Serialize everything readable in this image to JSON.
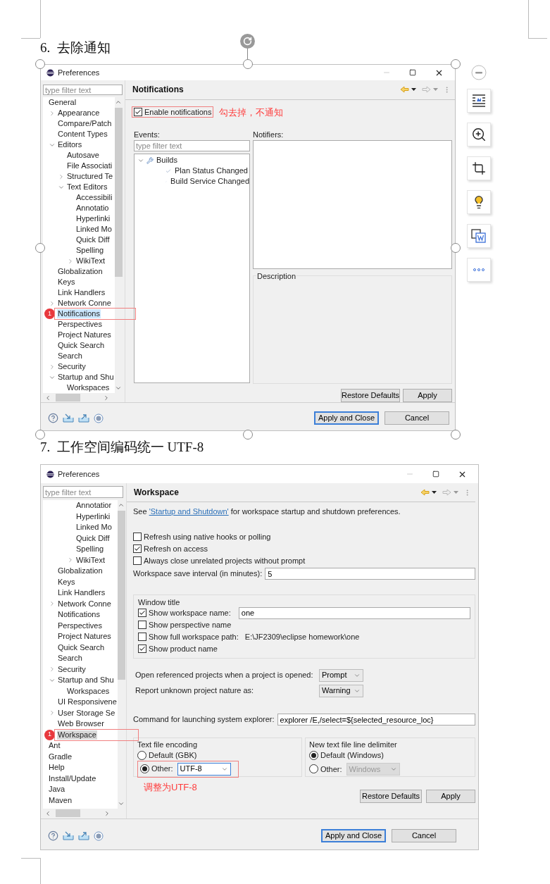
{
  "section_6": {
    "heading": "6.  去除通知",
    "dialog": {
      "title": "Preferences",
      "filter_placeholder": "type filter text",
      "tree": [
        {
          "label": "General",
          "selected": false,
          "children": [
            {
              "label": "Appearance",
              "expanded": false,
              "selected": false
            },
            {
              "label": "Compare/Patch",
              "selected": false
            },
            {
              "label": "Content Types",
              "selected": false
            },
            {
              "label": "Editors",
              "expanded": true,
              "selected": false,
              "children": [
                {
                  "label": "Autosave",
                  "selected": false
                },
                {
                  "label": "File Associati",
                  "selected": false
                },
                {
                  "label": "Structured Te",
                  "expanded": false,
                  "selected": false
                },
                {
                  "label": "Text Editors",
                  "expanded": true,
                  "selected": false,
                  "children": [
                    {
                      "label": "Accessibili",
                      "selected": false
                    },
                    {
                      "label": "Annotatio",
                      "selected": false
                    },
                    {
                      "label": "Hyperlinki",
                      "selected": false
                    },
                    {
                      "label": "Linked Mo",
                      "selected": false
                    },
                    {
                      "label": "Quick Diff",
                      "selected": false
                    },
                    {
                      "label": "Spelling",
                      "selected": false
                    },
                    {
                      "label": "WikiText",
                      "expanded": false,
                      "selected": false
                    }
                  ]
                }
              ]
            },
            {
              "label": "Globalization",
              "selected": false
            },
            {
              "label": "Keys",
              "selected": false
            },
            {
              "label": "Link Handlers",
              "selected": false
            },
            {
              "label": "Network Conne",
              "expanded": false,
              "selected": false
            },
            {
              "label": "Notifications",
              "selected": true,
              "marker": "1"
            },
            {
              "label": "Perspectives",
              "selected": false
            },
            {
              "label": "Project Natures",
              "selected": false
            },
            {
              "label": "Quick Search",
              "selected": false
            },
            {
              "label": "Search",
              "selected": false
            },
            {
              "label": "Security",
              "expanded": false,
              "selected": false
            },
            {
              "label": "Startup and Shu",
              "expanded": true,
              "selected": false,
              "children": [
                {
                  "label": "Workspaces",
                  "selected": false
                }
              ]
            }
          ]
        }
      ],
      "page_title": "Notifications",
      "enable_checkbox": {
        "label": "Enable notifications",
        "checked": true,
        "annotated": true
      },
      "annotation": "勾去掉，不通知",
      "events_label": "Events:",
      "events_filter_placeholder": "type filter text",
      "events": [
        {
          "label": "Builds",
          "expanded": true,
          "children": [
            {
              "label": "Plan Status Changed"
            },
            {
              "label": "Build Service Changed"
            }
          ]
        }
      ],
      "notifiers_label": "Notifiers:",
      "description_label": "Description",
      "page_buttons": [
        "Restore Defaults",
        "Apply"
      ],
      "dialog_buttons": [
        {
          "label": "Apply and Close",
          "default": true
        },
        {
          "label": "Cancel",
          "default": false
        }
      ]
    }
  },
  "section_7": {
    "heading": "7.  工作空间编码统一 UTF-8",
    "dialog": {
      "title": "Preferences",
      "filter_placeholder": "type filter text",
      "tree": [
        {
          "children": [
            {
              "children": [
                {
                  "children": [
                    {
                      "label": "Annotatior",
                      "selected": false
                    },
                    {
                      "label": "Hyperlinki",
                      "selected": false
                    },
                    {
                      "label": "Linked Mo",
                      "selected": false
                    },
                    {
                      "label": "Quick Diff",
                      "selected": false
                    },
                    {
                      "label": "Spelling",
                      "selected": false
                    },
                    {
                      "label": "WikiText",
                      "expanded": false,
                      "selected": false
                    }
                  ]
                }
              ]
            },
            {
              "label": "Globalization",
              "selected": false
            },
            {
              "label": "Keys",
              "selected": false
            },
            {
              "label": "Link Handlers",
              "selected": false
            },
            {
              "label": "Network Conne",
              "expanded": false,
              "selected": false
            },
            {
              "label": "Notifications",
              "selected": false
            },
            {
              "label": "Perspectives",
              "selected": false
            },
            {
              "label": "Project Natures",
              "selected": false
            },
            {
              "label": "Quick Search",
              "selected": false
            },
            {
              "label": "Search",
              "selected": false
            },
            {
              "label": "Security",
              "expanded": false,
              "selected": false
            },
            {
              "label": "Startup and Shu",
              "expanded": true,
              "selected": false,
              "children": [
                {
                  "label": "Workspaces",
                  "selected": false
                }
              ]
            },
            {
              "label": "UI Responsivene",
              "selected": false
            },
            {
              "label": "User Storage Se",
              "expanded": false,
              "selected": false
            },
            {
              "label": "Web Browser",
              "selected": false
            },
            {
              "label": "Workspace",
              "selected": true,
              "marker": "1"
            }
          ]
        },
        {
          "label": "Ant",
          "selected": false
        },
        {
          "label": "Gradle",
          "selected": false
        },
        {
          "label": "Help",
          "selected": false
        },
        {
          "label": "Install/Update",
          "selected": false
        },
        {
          "label": "Java",
          "selected": false
        },
        {
          "label": "Maven",
          "selected": false
        }
      ],
      "page_title": "Workspace",
      "intro": {
        "before": "See ",
        "link": "'Startup and Shutdown'",
        "after": " for workspace startup and shutdown preferences."
      },
      "options": [
        {
          "label": "Refresh using native hooks or polling",
          "checked": false
        },
        {
          "label": "Refresh on access",
          "checked": true
        },
        {
          "label": "Always close unrelated projects without prompt",
          "checked": false
        }
      ],
      "save_interval": {
        "label": "Workspace save interval (in minutes):",
        "value": "5"
      },
      "window_title_group": {
        "title": "Window title",
        "items": [
          {
            "kind": "field",
            "label": "Show workspace name:",
            "checked": true,
            "value": "one"
          },
          {
            "kind": "plain",
            "label": "Show perspective name",
            "checked": false
          },
          {
            "kind": "path",
            "label": "Show full workspace path:",
            "checked": false,
            "value": "E:\\JF2309\\eclipse homework\\one"
          },
          {
            "kind": "plain",
            "label": "Show product name",
            "checked": true
          }
        ]
      },
      "selects": [
        {
          "label": "Open referenced projects when a project is opened:",
          "value": "Prompt"
        },
        {
          "label": "Report unknown project nature as:",
          "value": "Warning"
        }
      ],
      "explorer_command": {
        "label": "Command for launching system explorer:",
        "value": "explorer /E,/select=${selected_resource_loc}"
      },
      "encoding_group": {
        "title": "Text file encoding",
        "options": [
          {
            "kind": "plain",
            "label": "Default (GBK)",
            "selected": false
          },
          {
            "kind": "select",
            "label": "Other:",
            "selected": true,
            "value": "UTF-8",
            "annotated": true,
            "disabled": false
          }
        ]
      },
      "annotation": "调整为UTF-8",
      "delimiter_group": {
        "title": "New text file line delimiter",
        "options": [
          {
            "kind": "plain",
            "label": "Default (Windows)",
            "selected": true
          },
          {
            "kind": "select",
            "label": "Other:",
            "selected": false,
            "value": "Windows",
            "disabled": true
          }
        ]
      },
      "page_buttons": [
        "Restore Defaults",
        "Apply"
      ],
      "dialog_buttons": [
        {
          "label": "Apply and Close",
          "default": true
        },
        {
          "label": "Cancel",
          "default": false
        }
      ]
    }
  }
}
